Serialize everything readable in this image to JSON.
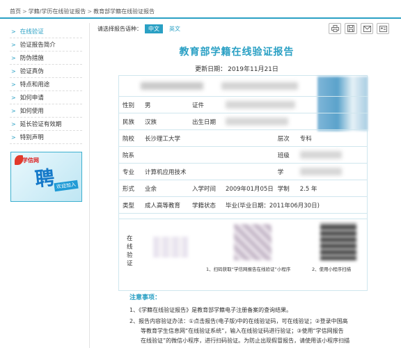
{
  "breadcrumb": [
    "首页",
    "学籍/学历在线验证报告",
    "教育部学籍在线验证报告"
  ],
  "sidebar": {
    "items": [
      {
        "label": "在线验证",
        "active": true
      },
      {
        "label": "验证报告简介"
      },
      {
        "label": "防伪措施"
      },
      {
        "label": "验证真伪"
      },
      {
        "label": "特点和用途"
      },
      {
        "label": "如何申请"
      },
      {
        "label": "如何使用"
      },
      {
        "label": "延长验证有效期"
      },
      {
        "label": "特别声明"
      }
    ],
    "banner": {
      "logo": "学信网",
      "big": "聘",
      "sub": "欢迎加入"
    }
  },
  "language": {
    "prompt": "请选择报告语种：",
    "options": [
      "中文",
      "英文"
    ],
    "selected": "中文"
  },
  "toolbar": {
    "icons": [
      "print-icon",
      "save-icon",
      "email-icon",
      "contact-card-icon"
    ]
  },
  "report": {
    "title": "教育部学籍在线验证报告",
    "update_label": "更新日期：",
    "update_date": "2019年11月21日",
    "rows": {
      "gender_label": "性别",
      "gender": "男",
      "cert_label": "证件",
      "ethnicity_label": "民族",
      "ethnicity": "汉族",
      "birth_label": "出生日期",
      "school_label": "院校",
      "school": "长沙理工大学",
      "level_label": "层次",
      "level": "专科",
      "dept_label": "院系",
      "class_label": "班级",
      "major_label": "专业",
      "major": "计算机应用技术",
      "studentno_label": "学",
      "form_label": "形式",
      "form": "业余",
      "enroll_label": "入学时间",
      "enroll": "2009年01月05日",
      "duration_label": "学制",
      "duration": "2.5 年",
      "type_label": "类型",
      "type": "成人高等教育",
      "status_label": "学籍状态",
      "status": "毕业(毕业日期：2011年06月30日)"
    },
    "verify": {
      "label": "在线验证",
      "caption1": "1、扫码获取“学信网报告在线验证”小程序",
      "caption2": "2、使用小程序扫描"
    }
  },
  "notice": {
    "title": "注意事项：",
    "lines": [
      "1、《学籍在线验证报告》是教育部学籍电子注册备案的查询结果。",
      "2、报告内容验证办法：①点击报告(电子版)中的在线验证码，可在线验证；②登录中国高",
      "等教育学生信息网“在线验证系统”，输入在线验证码进行验证；③使用“学信网报告",
      "在线验证”的微信小程序，进行扫码验证。为防止出现假冒报告，请使用该小程序扫描"
    ]
  }
}
